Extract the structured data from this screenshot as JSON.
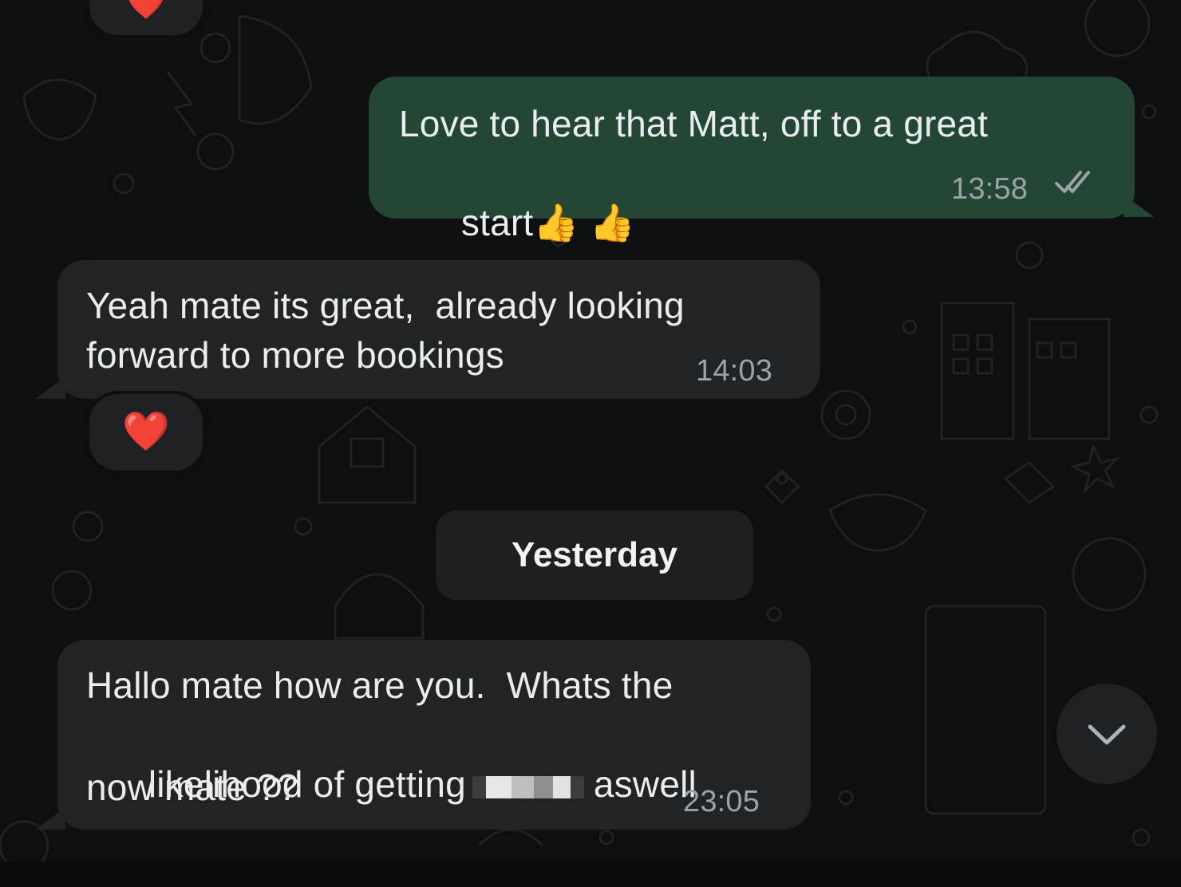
{
  "colors": {
    "outgoing_bubble": "#244635",
    "incoming_bubble": "#202426",
    "chat_background": "#0d0f10",
    "timestamp": "#9aa3a7",
    "tick_color": "#9aa3a7"
  },
  "messages": [
    {
      "direction": "outgoing",
      "line1": "Love to hear that Matt, off to a great",
      "line2": "start",
      "emojis": "👍 👍",
      "time": "13:58",
      "status_icon": "double-check-icon"
    },
    {
      "direction": "incoming",
      "line1": "Yeah mate its great,  already looking",
      "line2": "forward to more bookings",
      "time": "14:03",
      "reaction": "❤️"
    },
    {
      "direction": "incoming",
      "line1": "Hallo mate how are you.  Whats the",
      "line2a": "likelihood of getting",
      "line2b": "aswell",
      "line3": "now mate ??",
      "time": "23:05"
    }
  ],
  "date_separator": "Yesterday",
  "top_reaction": "❤️",
  "scroll_button_icon": "chevron-down-icon"
}
